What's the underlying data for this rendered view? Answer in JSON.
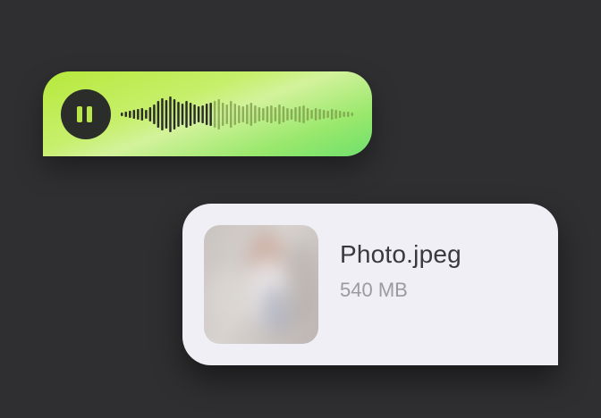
{
  "voice_message": {
    "icon": "pause-icon",
    "waveform_played_fraction": 0.4,
    "colors": {
      "bubble_gradient": [
        "#b6e93b",
        "#d3f29b",
        "#6fe06d"
      ],
      "button_bg": "#2b2d2a",
      "icon_color": "#b9e64a",
      "played_bar": "#2b2d2a",
      "unplayed_bar": "#7a9a45"
    }
  },
  "file_attachment": {
    "name": "Photo.jpeg",
    "size": "540 MB",
    "thumbnail": "blurred-photo-thumbnail",
    "colors": {
      "bubble_bg": "#efeff5",
      "name_color": "#3a3a3d",
      "size_color": "#9a9aa1"
    }
  },
  "colors": {
    "background": "#2f2e30"
  }
}
